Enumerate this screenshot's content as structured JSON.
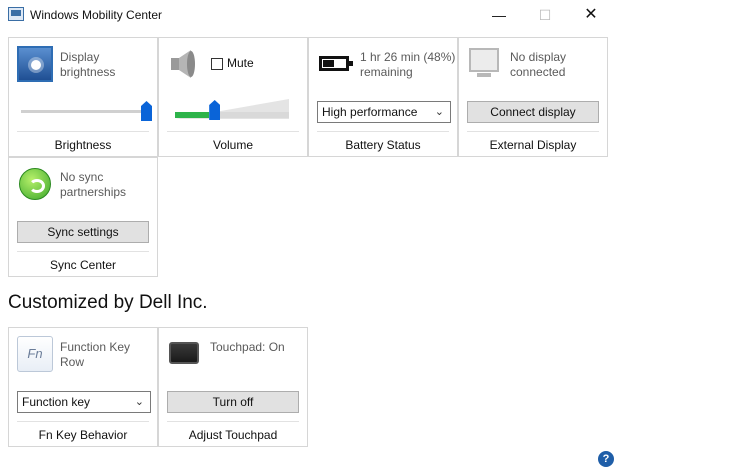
{
  "window": {
    "title": "Windows Mobility Center",
    "minimize_glyph": "—",
    "maximize_glyph": "☐",
    "close_glyph": "✕"
  },
  "tiles": {
    "brightness": {
      "description": "Display brightness",
      "label": "Brightness",
      "level": 1.0
    },
    "volume": {
      "mute_label": "Mute",
      "muted": false,
      "label": "Volume",
      "level": 0.3
    },
    "battery": {
      "description": "1 hr 26 min (48%) remaining",
      "plan_selected": "High performance",
      "label": "Battery Status",
      "charge_fraction": 0.48
    },
    "external_display": {
      "description": "No display connected",
      "button_label": "Connect display",
      "label": "External Display"
    },
    "sync_center": {
      "description": "No sync partnerships",
      "button_label": "Sync settings",
      "label": "Sync Center"
    }
  },
  "custom_section": {
    "heading": "Customized by Dell Inc.",
    "fn_key": {
      "icon_text": "Fn",
      "description": "Function Key Row",
      "selected": "Function key",
      "label": "Fn Key Behavior"
    },
    "touchpad": {
      "description": "Touchpad: On",
      "button_label": "Turn off",
      "label": "Adjust Touchpad"
    }
  },
  "help": {
    "glyph": "?"
  },
  "icons": {
    "brightness": "brightness-icon",
    "volume": "speaker-icon",
    "battery": "battery-icon",
    "external_display": "monitor-icon",
    "sync": "sync-icon",
    "fn": "fn-key-icon",
    "touchpad": "touchpad-icon",
    "help": "help-icon"
  },
  "colors": {
    "slider_thumb": "#0a64d8",
    "volume_fill": "#2db34a",
    "help": "#1f5ea8"
  }
}
